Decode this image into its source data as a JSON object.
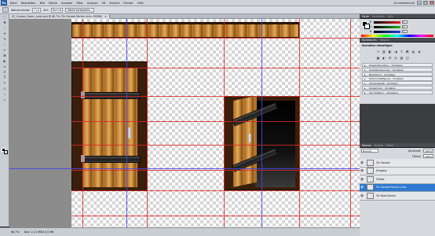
{
  "menubar": {
    "logo": "Ps",
    "items": [
      "Datei",
      "Bearbeiten",
      "Bild",
      "Ebene",
      "Auswahl",
      "Filter",
      "Analyse",
      "3D",
      "Ansicht",
      "Fenster",
      "Hilfe"
    ],
    "workspace": "Grundelemente",
    "minimize": "–",
    "maximize": "□",
    "close": "×"
  },
  "options": {
    "feather_label": "Weiche Kante:",
    "feather_value": "0 px",
    "style_label": "Stil:",
    "style_value": "Normal",
    "refine_button": "Kante verbessern..."
  },
  "document": {
    "tab_title": "DF_Custom_Doors_Level.psd @ 66,7% (Tür Gerade Rechts Links, RGB/8)",
    "tab_close": "×"
  },
  "toolbox": {
    "tools": [
      "⬚",
      "✥",
      "◌",
      "⌖",
      "✎",
      "⟋",
      "✂",
      "⌘",
      "◐",
      "▭",
      "✐",
      "T",
      "↖",
      "◇",
      "☝",
      "⌕"
    ]
  },
  "statusbar": {
    "zoom": "66,7%",
    "doc_info": "Dok: 2,11 MB/10,5 MB"
  },
  "color_panel": {
    "tabs": [
      "Farbe",
      "Farbfelder",
      "Stile"
    ],
    "sliders": [
      {
        "label": "R",
        "value": "0",
        "color": "#e02020"
      },
      {
        "label": "G",
        "value": "0",
        "color": "#20b020"
      },
      {
        "label": "B",
        "value": "0",
        "color": "#2040e0"
      }
    ]
  },
  "adjustments_panel": {
    "tabs": [
      "Korrekturen",
      "Masken"
    ],
    "title": "Korrektur hinzufügen",
    "icons": [
      "☼",
      "▥",
      "◧",
      "◑",
      "▽",
      "◩",
      "▤",
      "◈",
      "▦",
      "◐",
      "☰",
      "◎",
      "▧",
      "◫"
    ]
  },
  "presets": [
    "Tonwertkorrektur - Vorgaben",
    "Gradationskurven - Vorgaben",
    "Belichtung - Vorgaben",
    "Farbton/Sättigung - Vorgaben",
    "Schwarzweiß - Vorgaben",
    "Kanalmixer - Vorgaben",
    "Sel. Farbkorr. - Vorgaben"
  ],
  "layers_panel": {
    "tabs": [
      "Ebenen",
      "Kanäle",
      "Pfade"
    ],
    "blend_mode": "Normal",
    "opacity_label": "Deckkraft:",
    "opacity_value": "100%",
    "fill_label": "Fläche:",
    "fill_value": "100%",
    "layers": [
      {
        "name": "Tür Gerade",
        "active": false
      },
      {
        "name": "Umgang",
        "active": false
      },
      {
        "name": "Türfalz",
        "active": false
      },
      {
        "name": "Tür Gerade Rechts Links",
        "active": true
      },
      {
        "name": "Tür Breit Rechts",
        "active": false
      }
    ],
    "footer_icons": [
      "⛓",
      "fx",
      "◐",
      "▣",
      "▢",
      "🗑"
    ]
  }
}
